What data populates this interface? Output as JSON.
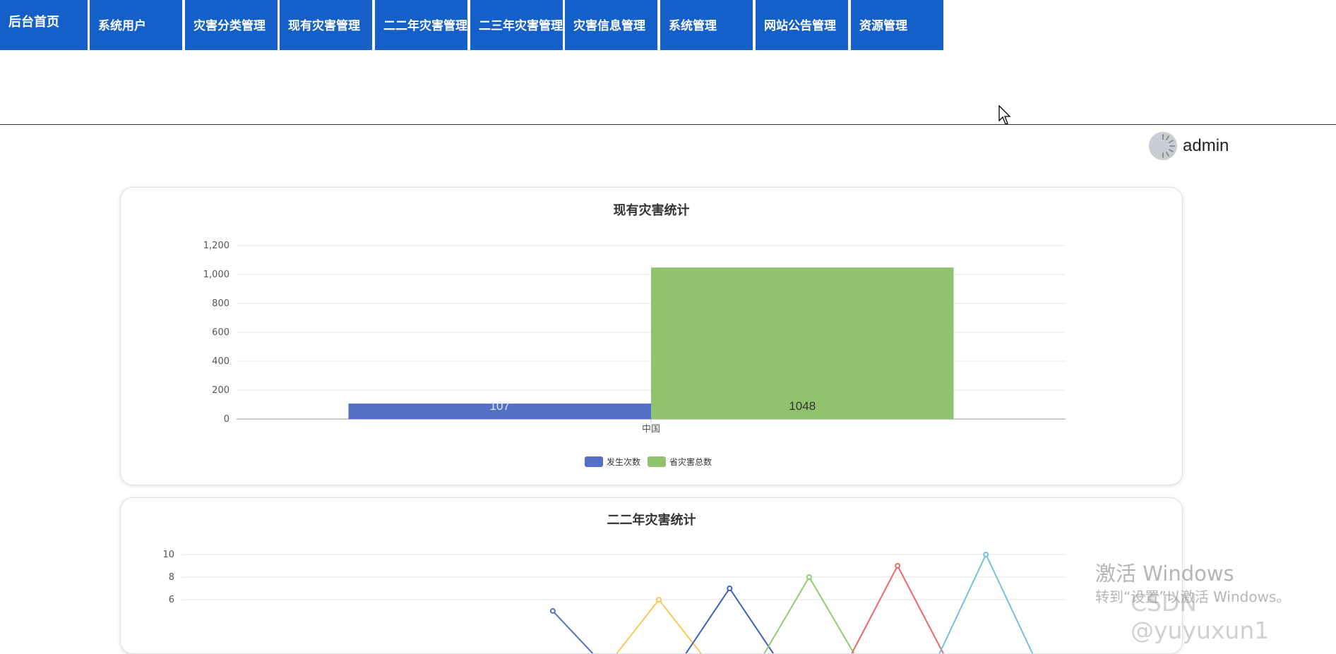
{
  "nav": {
    "items": [
      {
        "label": "后台首页"
      },
      {
        "label": "系统用户"
      },
      {
        "label": "灾害分类管理"
      },
      {
        "label": "现有灾害管理"
      },
      {
        "label": "二二年灾害管理"
      },
      {
        "label": "二三年灾害管理"
      },
      {
        "label": "灾害信息管理"
      },
      {
        "label": "系统管理"
      },
      {
        "label": "网站公告管理"
      },
      {
        "label": "资源管理"
      }
    ],
    "color": "#1560c8"
  },
  "user": {
    "name": "admin",
    "avatar_icon": "loading-avatar-icon"
  },
  "chart_data": [
    {
      "type": "bar",
      "title": "现有灾害统计",
      "categories": [
        "中国"
      ],
      "series": [
        {
          "name": "发生次数",
          "values": [
            107
          ],
          "color": "#5470c6"
        },
        {
          "name": "省灾害总数",
          "values": [
            1048
          ],
          "color": "#91c36f"
        }
      ],
      "ylim": [
        0,
        1200
      ],
      "yticks": [
        "0",
        "200",
        "400",
        "600",
        "800",
        "1,000",
        "1,200"
      ],
      "grid": true,
      "legend": "bottom-center"
    },
    {
      "type": "line",
      "title": "二二年灾害统计",
      "ylim": [
        0,
        10
      ],
      "yticks": [
        "6",
        "8",
        "10"
      ],
      "grid": true,
      "series": [
        {
          "color": "#5470c6",
          "points": [
            [
              0.42,
              5
            ],
            [
              0.48,
              0
            ],
            [
              0.54,
              0
            ]
          ]
        },
        {
          "color": "#fac858",
          "points": [
            [
              0.48,
              0
            ],
            [
              0.54,
              6
            ],
            [
              0.6,
              0
            ]
          ]
        },
        {
          "color": "#3b5fc0",
          "points": [
            [
              0.56,
              0
            ],
            [
              0.62,
              7
            ],
            [
              0.68,
              0
            ]
          ]
        },
        {
          "color": "#91cc75",
          "points": [
            [
              0.65,
              0
            ],
            [
              0.71,
              8
            ],
            [
              0.77,
              0
            ]
          ]
        },
        {
          "color": "#ee6666",
          "points": [
            [
              0.75,
              0
            ],
            [
              0.81,
              9
            ],
            [
              0.87,
              0
            ]
          ]
        },
        {
          "color": "#73c0de",
          "points": [
            [
              0.85,
              0
            ],
            [
              0.91,
              10
            ],
            [
              0.97,
              0
            ]
          ]
        }
      ]
    }
  ],
  "watermark": {
    "activate_title": "激活 Windows",
    "activate_sub": "转到“设置”以激活 Windows。",
    "csdn": "CSDN @yuyuxun1"
  }
}
